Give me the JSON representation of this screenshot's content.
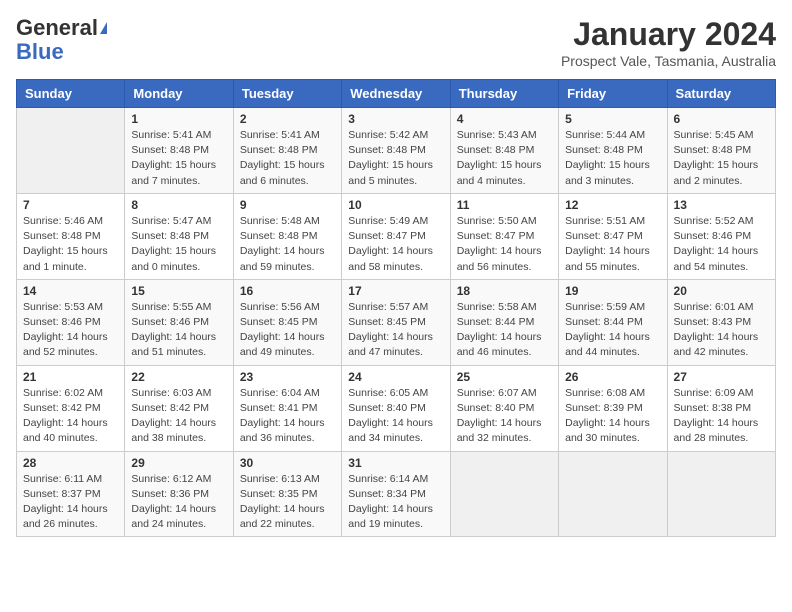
{
  "logo": {
    "line1": "General",
    "line2": "Blue"
  },
  "title": "January 2024",
  "subtitle": "Prospect Vale, Tasmania, Australia",
  "headers": [
    "Sunday",
    "Monday",
    "Tuesday",
    "Wednesday",
    "Thursday",
    "Friday",
    "Saturday"
  ],
  "weeks": [
    [
      {
        "day": "",
        "info": ""
      },
      {
        "day": "1",
        "info": "Sunrise: 5:41 AM\nSunset: 8:48 PM\nDaylight: 15 hours\nand 7 minutes."
      },
      {
        "day": "2",
        "info": "Sunrise: 5:41 AM\nSunset: 8:48 PM\nDaylight: 15 hours\nand 6 minutes."
      },
      {
        "day": "3",
        "info": "Sunrise: 5:42 AM\nSunset: 8:48 PM\nDaylight: 15 hours\nand 5 minutes."
      },
      {
        "day": "4",
        "info": "Sunrise: 5:43 AM\nSunset: 8:48 PM\nDaylight: 15 hours\nand 4 minutes."
      },
      {
        "day": "5",
        "info": "Sunrise: 5:44 AM\nSunset: 8:48 PM\nDaylight: 15 hours\nand 3 minutes."
      },
      {
        "day": "6",
        "info": "Sunrise: 5:45 AM\nSunset: 8:48 PM\nDaylight: 15 hours\nand 2 minutes."
      }
    ],
    [
      {
        "day": "7",
        "info": "Sunrise: 5:46 AM\nSunset: 8:48 PM\nDaylight: 15 hours\nand 1 minute."
      },
      {
        "day": "8",
        "info": "Sunrise: 5:47 AM\nSunset: 8:48 PM\nDaylight: 15 hours\nand 0 minutes."
      },
      {
        "day": "9",
        "info": "Sunrise: 5:48 AM\nSunset: 8:48 PM\nDaylight: 14 hours\nand 59 minutes."
      },
      {
        "day": "10",
        "info": "Sunrise: 5:49 AM\nSunset: 8:47 PM\nDaylight: 14 hours\nand 58 minutes."
      },
      {
        "day": "11",
        "info": "Sunrise: 5:50 AM\nSunset: 8:47 PM\nDaylight: 14 hours\nand 56 minutes."
      },
      {
        "day": "12",
        "info": "Sunrise: 5:51 AM\nSunset: 8:47 PM\nDaylight: 14 hours\nand 55 minutes."
      },
      {
        "day": "13",
        "info": "Sunrise: 5:52 AM\nSunset: 8:46 PM\nDaylight: 14 hours\nand 54 minutes."
      }
    ],
    [
      {
        "day": "14",
        "info": "Sunrise: 5:53 AM\nSunset: 8:46 PM\nDaylight: 14 hours\nand 52 minutes."
      },
      {
        "day": "15",
        "info": "Sunrise: 5:55 AM\nSunset: 8:46 PM\nDaylight: 14 hours\nand 51 minutes."
      },
      {
        "day": "16",
        "info": "Sunrise: 5:56 AM\nSunset: 8:45 PM\nDaylight: 14 hours\nand 49 minutes."
      },
      {
        "day": "17",
        "info": "Sunrise: 5:57 AM\nSunset: 8:45 PM\nDaylight: 14 hours\nand 47 minutes."
      },
      {
        "day": "18",
        "info": "Sunrise: 5:58 AM\nSunset: 8:44 PM\nDaylight: 14 hours\nand 46 minutes."
      },
      {
        "day": "19",
        "info": "Sunrise: 5:59 AM\nSunset: 8:44 PM\nDaylight: 14 hours\nand 44 minutes."
      },
      {
        "day": "20",
        "info": "Sunrise: 6:01 AM\nSunset: 8:43 PM\nDaylight: 14 hours\nand 42 minutes."
      }
    ],
    [
      {
        "day": "21",
        "info": "Sunrise: 6:02 AM\nSunset: 8:42 PM\nDaylight: 14 hours\nand 40 minutes."
      },
      {
        "day": "22",
        "info": "Sunrise: 6:03 AM\nSunset: 8:42 PM\nDaylight: 14 hours\nand 38 minutes."
      },
      {
        "day": "23",
        "info": "Sunrise: 6:04 AM\nSunset: 8:41 PM\nDaylight: 14 hours\nand 36 minutes."
      },
      {
        "day": "24",
        "info": "Sunrise: 6:05 AM\nSunset: 8:40 PM\nDaylight: 14 hours\nand 34 minutes."
      },
      {
        "day": "25",
        "info": "Sunrise: 6:07 AM\nSunset: 8:40 PM\nDaylight: 14 hours\nand 32 minutes."
      },
      {
        "day": "26",
        "info": "Sunrise: 6:08 AM\nSunset: 8:39 PM\nDaylight: 14 hours\nand 30 minutes."
      },
      {
        "day": "27",
        "info": "Sunrise: 6:09 AM\nSunset: 8:38 PM\nDaylight: 14 hours\nand 28 minutes."
      }
    ],
    [
      {
        "day": "28",
        "info": "Sunrise: 6:11 AM\nSunset: 8:37 PM\nDaylight: 14 hours\nand 26 minutes."
      },
      {
        "day": "29",
        "info": "Sunrise: 6:12 AM\nSunset: 8:36 PM\nDaylight: 14 hours\nand 24 minutes."
      },
      {
        "day": "30",
        "info": "Sunrise: 6:13 AM\nSunset: 8:35 PM\nDaylight: 14 hours\nand 22 minutes."
      },
      {
        "day": "31",
        "info": "Sunrise: 6:14 AM\nSunset: 8:34 PM\nDaylight: 14 hours\nand 19 minutes."
      },
      {
        "day": "",
        "info": ""
      },
      {
        "day": "",
        "info": ""
      },
      {
        "day": "",
        "info": ""
      }
    ]
  ]
}
